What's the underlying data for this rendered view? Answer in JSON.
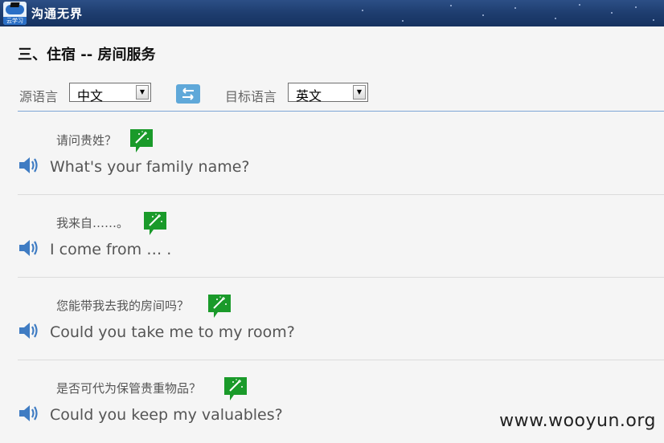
{
  "app": {
    "title": "沟通无界",
    "logo_text": "云学习"
  },
  "section_title": "三、住宿 -- 房间服务",
  "language": {
    "source_label": "源语言",
    "source_value": "中文",
    "target_label": "目标语言",
    "target_value": "英文"
  },
  "phrases": [
    {
      "zh": "请问贵姓？",
      "en": "What's your family name?"
    },
    {
      "zh": "我来自……。",
      "en": "I come from … ."
    },
    {
      "zh": "您能带我去我的房间吗？",
      "en": "Could you take me to my room?"
    },
    {
      "zh": "是否可代为保管贵重物品？",
      "en": "Could you keep my valuables?"
    }
  ],
  "watermark": "www.wooyun.org",
  "icons": {
    "speaker": "speaker-icon",
    "magic": "magic-wand-bubble-icon",
    "swap": "swap-arrows-icon",
    "dropdown": "chevron-down-icon"
  },
  "colors": {
    "titlebar": "#1e3d6f",
    "accent_blue": "#3f7cc3",
    "magic_green": "#1a9a2a",
    "swap_blue": "#5fa8d9"
  }
}
